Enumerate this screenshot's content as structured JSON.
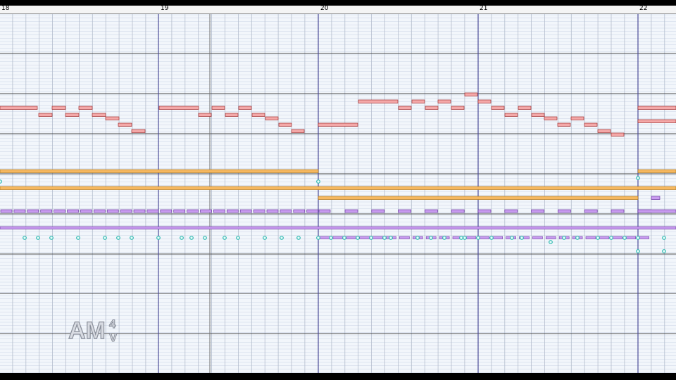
{
  "ruler": {
    "measures": [
      "18",
      "19",
      "20",
      "21",
      "22"
    ]
  },
  "watermark": {
    "text": "AM4V"
  },
  "colors": {
    "background": "#000000",
    "roll_background": "#f2f6fb",
    "semitone_line": "#c9d3e6",
    "beat_line": "#b4bdcd",
    "octave_line": "#4a4a4a",
    "bar_line": "#4c4c98",
    "melody_note": "#f4a8a8",
    "melody_note_border": "#a03030",
    "orange_note": "#f6b860",
    "purple_note": "#c99bf0",
    "event_dot": "#2fb8b0"
  }
}
